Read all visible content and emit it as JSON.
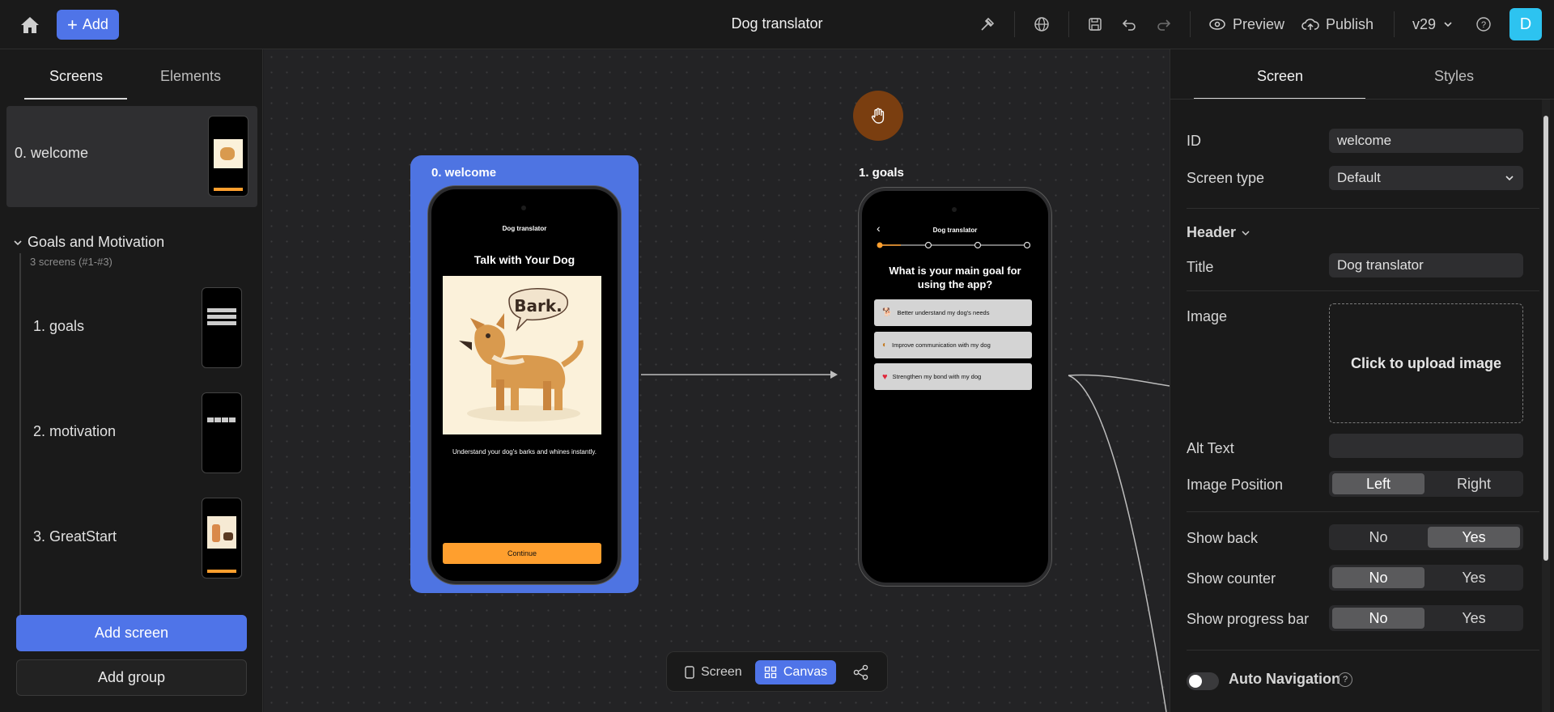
{
  "topbar": {
    "add_label": "Add",
    "title": "Dog translator",
    "preview_label": "Preview",
    "publish_label": "Publish",
    "version": "v29",
    "avatar_letter": "D"
  },
  "left": {
    "tabs": [
      "Screens",
      "Elements"
    ],
    "screens": [
      {
        "label": "0.  welcome"
      }
    ],
    "group": {
      "title": "Goals and Motivation",
      "subtitle": "3 screens (#1-#3)",
      "items": [
        {
          "label": "1.  goals"
        },
        {
          "label": "2.  motivation"
        },
        {
          "label": "3.  GreatStart"
        }
      ]
    },
    "add_screen": "Add screen",
    "add_group": "Add group"
  },
  "canvas": {
    "welcome": {
      "card_title": "0. welcome",
      "header": "Dog translator",
      "heading": "Talk with Your Dog",
      "bubble": "Bark.",
      "text": "Understand your dog's barks and whines instantly.",
      "button": "Continue"
    },
    "goals": {
      "card_title": "1. goals",
      "header": "Dog translator",
      "question": "What is your main goal for using the app?",
      "options": [
        {
          "icon": "dog-icon",
          "label": "Better understand my dog's needs"
        },
        {
          "icon": "ear-icon",
          "label": "Improve communication with my dog"
        },
        {
          "icon": "heart-icon",
          "label": "Strengthen my bond with my dog"
        }
      ]
    },
    "toolbar": {
      "screen_label": "Screen",
      "canvas_label": "Canvas"
    }
  },
  "right": {
    "tabs": [
      "Screen",
      "Styles"
    ],
    "id_label": "ID",
    "id_value": "welcome",
    "screen_type_label": "Screen type",
    "screen_type_value": "Default",
    "header_section": "Header",
    "title_label": "Title",
    "title_value": "Dog translator",
    "image_label": "Image",
    "upload_text": "Click to upload image",
    "alt_text_label": "Alt Text",
    "alt_text_value": "",
    "image_position_label": "Image Position",
    "image_position_options": [
      "Left",
      "Right"
    ],
    "show_back_label": "Show back",
    "show_counter_label": "Show counter",
    "show_progress_label": "Show progress bar",
    "no_label": "No",
    "yes_label": "Yes",
    "auto_nav_label": "Auto Navigation",
    "help": "?"
  },
  "colors": {
    "accent": "#4f74e8",
    "continue": "#ff9f2e",
    "avatar": "#2dc3f0"
  }
}
